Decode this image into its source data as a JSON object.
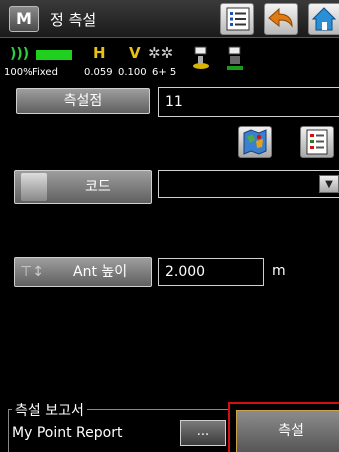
{
  "titlebar": {
    "app_icon_letter": "M",
    "title": "정 측설"
  },
  "status": {
    "battery": "100%",
    "fix": "Fixed",
    "h_label": "H",
    "h_value": "0.059",
    "v_label": "V",
    "v_value": "0.100",
    "satellites": "6+ 5",
    "battery_color": "#1fd01f",
    "hv_color": "#e8c018"
  },
  "form": {
    "point_label": "측설점",
    "point_value": "11",
    "code_label": "코드",
    "code_value": "",
    "antenna_label": "Ant 높이",
    "antenna_value": "2.000",
    "antenna_unit": "m"
  },
  "report": {
    "legend": "측설 보고서",
    "value": "My Point Report",
    "browse_label": "..."
  },
  "actions": {
    "measure_label": "측설",
    "highlight_color": "#d21010"
  },
  "icons": {
    "list": "list-icon",
    "back": "back-arrow-icon",
    "home": "home-icon",
    "map": "map-icon",
    "point_list": "point-list-icon",
    "code": "code-book-icon",
    "antenna": "antenna-height-icon",
    "dropdown": "chevron-down-icon"
  }
}
